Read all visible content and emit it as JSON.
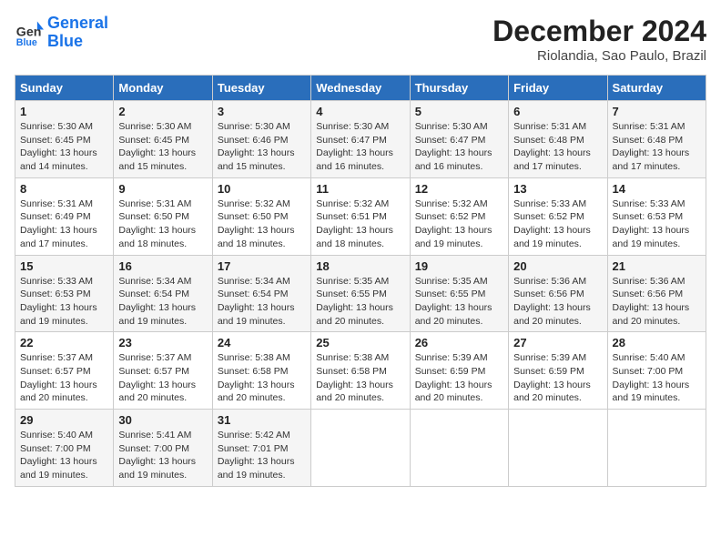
{
  "header": {
    "logo_line1": "General",
    "logo_line2": "Blue",
    "month_title": "December 2024",
    "location": "Riolandia, Sao Paulo, Brazil"
  },
  "days_of_week": [
    "Sunday",
    "Monday",
    "Tuesday",
    "Wednesday",
    "Thursday",
    "Friday",
    "Saturday"
  ],
  "weeks": [
    [
      {
        "day": "1",
        "sunrise": "5:30 AM",
        "sunset": "6:45 PM",
        "daylight": "13 hours and 14 minutes."
      },
      {
        "day": "2",
        "sunrise": "5:30 AM",
        "sunset": "6:45 PM",
        "daylight": "13 hours and 15 minutes."
      },
      {
        "day": "3",
        "sunrise": "5:30 AM",
        "sunset": "6:46 PM",
        "daylight": "13 hours and 15 minutes."
      },
      {
        "day": "4",
        "sunrise": "5:30 AM",
        "sunset": "6:47 PM",
        "daylight": "13 hours and 16 minutes."
      },
      {
        "day": "5",
        "sunrise": "5:30 AM",
        "sunset": "6:47 PM",
        "daylight": "13 hours and 16 minutes."
      },
      {
        "day": "6",
        "sunrise": "5:31 AM",
        "sunset": "6:48 PM",
        "daylight": "13 hours and 17 minutes."
      },
      {
        "day": "7",
        "sunrise": "5:31 AM",
        "sunset": "6:48 PM",
        "daylight": "13 hours and 17 minutes."
      }
    ],
    [
      {
        "day": "8",
        "sunrise": "5:31 AM",
        "sunset": "6:49 PM",
        "daylight": "13 hours and 17 minutes."
      },
      {
        "day": "9",
        "sunrise": "5:31 AM",
        "sunset": "6:50 PM",
        "daylight": "13 hours and 18 minutes."
      },
      {
        "day": "10",
        "sunrise": "5:32 AM",
        "sunset": "6:50 PM",
        "daylight": "13 hours and 18 minutes."
      },
      {
        "day": "11",
        "sunrise": "5:32 AM",
        "sunset": "6:51 PM",
        "daylight": "13 hours and 18 minutes."
      },
      {
        "day": "12",
        "sunrise": "5:32 AM",
        "sunset": "6:52 PM",
        "daylight": "13 hours and 19 minutes."
      },
      {
        "day": "13",
        "sunrise": "5:33 AM",
        "sunset": "6:52 PM",
        "daylight": "13 hours and 19 minutes."
      },
      {
        "day": "14",
        "sunrise": "5:33 AM",
        "sunset": "6:53 PM",
        "daylight": "13 hours and 19 minutes."
      }
    ],
    [
      {
        "day": "15",
        "sunrise": "5:33 AM",
        "sunset": "6:53 PM",
        "daylight": "13 hours and 19 minutes."
      },
      {
        "day": "16",
        "sunrise": "5:34 AM",
        "sunset": "6:54 PM",
        "daylight": "13 hours and 19 minutes."
      },
      {
        "day": "17",
        "sunrise": "5:34 AM",
        "sunset": "6:54 PM",
        "daylight": "13 hours and 19 minutes."
      },
      {
        "day": "18",
        "sunrise": "5:35 AM",
        "sunset": "6:55 PM",
        "daylight": "13 hours and 20 minutes."
      },
      {
        "day": "19",
        "sunrise": "5:35 AM",
        "sunset": "6:55 PM",
        "daylight": "13 hours and 20 minutes."
      },
      {
        "day": "20",
        "sunrise": "5:36 AM",
        "sunset": "6:56 PM",
        "daylight": "13 hours and 20 minutes."
      },
      {
        "day": "21",
        "sunrise": "5:36 AM",
        "sunset": "6:56 PM",
        "daylight": "13 hours and 20 minutes."
      }
    ],
    [
      {
        "day": "22",
        "sunrise": "5:37 AM",
        "sunset": "6:57 PM",
        "daylight": "13 hours and 20 minutes."
      },
      {
        "day": "23",
        "sunrise": "5:37 AM",
        "sunset": "6:57 PM",
        "daylight": "13 hours and 20 minutes."
      },
      {
        "day": "24",
        "sunrise": "5:38 AM",
        "sunset": "6:58 PM",
        "daylight": "13 hours and 20 minutes."
      },
      {
        "day": "25",
        "sunrise": "5:38 AM",
        "sunset": "6:58 PM",
        "daylight": "13 hours and 20 minutes."
      },
      {
        "day": "26",
        "sunrise": "5:39 AM",
        "sunset": "6:59 PM",
        "daylight": "13 hours and 20 minutes."
      },
      {
        "day": "27",
        "sunrise": "5:39 AM",
        "sunset": "6:59 PM",
        "daylight": "13 hours and 20 minutes."
      },
      {
        "day": "28",
        "sunrise": "5:40 AM",
        "sunset": "7:00 PM",
        "daylight": "13 hours and 19 minutes."
      }
    ],
    [
      {
        "day": "29",
        "sunrise": "5:40 AM",
        "sunset": "7:00 PM",
        "daylight": "13 hours and 19 minutes."
      },
      {
        "day": "30",
        "sunrise": "5:41 AM",
        "sunset": "7:00 PM",
        "daylight": "13 hours and 19 minutes."
      },
      {
        "day": "31",
        "sunrise": "5:42 AM",
        "sunset": "7:01 PM",
        "daylight": "13 hours and 19 minutes."
      },
      null,
      null,
      null,
      null
    ]
  ]
}
